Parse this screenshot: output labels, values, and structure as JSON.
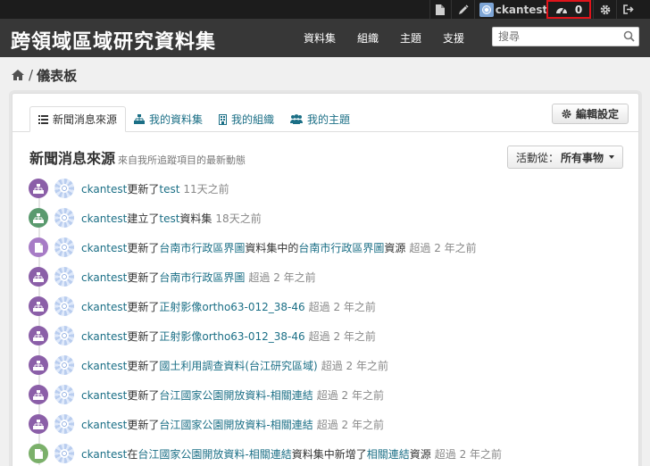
{
  "account": {
    "username": "ckantest",
    "dashboard_count": "0"
  },
  "masthead": {
    "site_title": "跨領域區域研究資料集",
    "nav": [
      "資料集",
      "組織",
      "主題",
      "支援"
    ],
    "search_placeholder": "搜尋"
  },
  "breadcrumb": {
    "separator": "/",
    "current": "儀表板"
  },
  "tabs": [
    {
      "label": "新聞消息來源",
      "icon": "list-icon"
    },
    {
      "label": "我的資料集",
      "icon": "sitemap-icon"
    },
    {
      "label": "我的組織",
      "icon": "building-icon"
    },
    {
      "label": "我的主題",
      "icon": "group-icon"
    }
  ],
  "edit_settings_label": "編輯設定",
  "news_feed": {
    "title": "新聞消息來源",
    "subtitle": "來自我所追蹤項目的最新動態",
    "filter_prefix": "活動從：",
    "filter_value": "所有事物"
  },
  "activities": [
    {
      "kind": "changed",
      "user": "ckantest",
      "parts": [
        "更新了",
        "test",
        ""
      ],
      "time": "11天之前"
    },
    {
      "kind": "new",
      "user": "ckantest",
      "parts": [
        "建立了",
        "test",
        "資料集"
      ],
      "time": "18天之前"
    },
    {
      "kind": "resource",
      "user": "ckantest",
      "parts": [
        "更新了",
        "台南市行政區界圖",
        "資料集中的",
        "台南市行政區界圖",
        "資源"
      ],
      "time": "超過 2 年之前"
    },
    {
      "kind": "changed",
      "user": "ckantest",
      "parts": [
        "更新了",
        "台南市行政區界圖",
        ""
      ],
      "time": "超過 2 年之前"
    },
    {
      "kind": "changed",
      "user": "ckantest",
      "parts": [
        "更新了",
        "正射影像ortho63-012_38-46",
        ""
      ],
      "time": "超過 2 年之前"
    },
    {
      "kind": "changed",
      "user": "ckantest",
      "parts": [
        "更新了",
        "正射影像ortho63-012_38-46",
        ""
      ],
      "time": "超過 2 年之前"
    },
    {
      "kind": "changed",
      "user": "ckantest",
      "parts": [
        "更新了",
        "國土利用調查資料(台江研究區域)",
        ""
      ],
      "time": "超過 2 年之前"
    },
    {
      "kind": "changed",
      "user": "ckantest",
      "parts": [
        "更新了",
        "台江國家公園開放資料-相關連結",
        ""
      ],
      "time": "超過 2 年之前"
    },
    {
      "kind": "changed",
      "user": "ckantest",
      "parts": [
        "更新了",
        "台江國家公園開放資料-相關連結",
        ""
      ],
      "time": "超過 2 年之前"
    },
    {
      "kind": "newres",
      "user": "ckantest",
      "parts": [
        "在",
        "台江國家公園開放資料-相關連結",
        "資料集中新增了",
        "相關連結",
        "資源"
      ],
      "time": "超過 2 年之前"
    }
  ],
  "colors": {
    "account_bar": "#1c1c1c",
    "masthead": "#373737",
    "link": "#1b6f86",
    "highlight_border": "#e0141b"
  }
}
